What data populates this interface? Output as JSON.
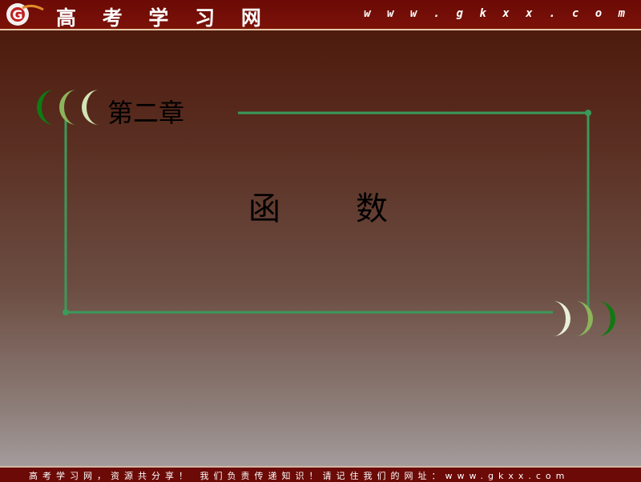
{
  "header": {
    "logo_letter": "G",
    "site_name": "高 考 学 习 网",
    "site_url": "w w w . g k x x . c o m"
  },
  "slide": {
    "chapter_label": "第二章",
    "title_chars": [
      "函",
      "数"
    ]
  },
  "footer": {
    "text": "高考学习网，资源共分享！ 我们负责传递知识！请记住我们的网址：www.gkxx.com"
  },
  "colors": {
    "frame_line": "#3a9a5a",
    "banner_red": "#6b0a06",
    "moon_dark": "#0f7a12",
    "moon_mid": "#8cb45a",
    "moon_light": "#d2e3b5"
  },
  "icons": {
    "logo": "gkxx-logo-icon",
    "left_ornament": "crescent-moons-icon",
    "right_ornament": "crescent-moons-icon"
  }
}
